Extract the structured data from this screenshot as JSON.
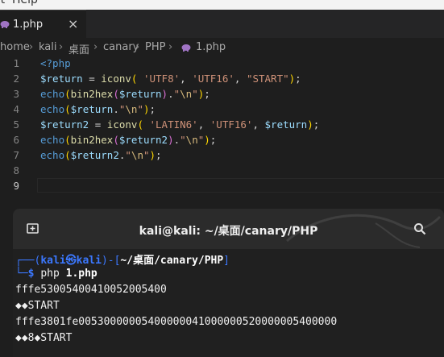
{
  "menubar": {
    "text": "at  Help"
  },
  "tab": {
    "label": "1.php",
    "close": "×"
  },
  "breadcrumb": [
    "home",
    "kali",
    "桌面",
    "canary",
    "PHP",
    "1.php"
  ],
  "breadcrumb_sep": "›",
  "editor": {
    "line_numbers": [
      "1",
      "2",
      "3",
      "4",
      "5",
      "6",
      "7",
      "8",
      "9"
    ],
    "active_line": "9"
  },
  "terminal": {
    "title": "kali@kali: ~/桌面/canary/PHP",
    "prompt_user": "kali㉿kali",
    "prompt_path": "~/桌面/canary/PHP",
    "command": "php",
    "command_arg": "1.php",
    "output": [
      "fffe53005400410052005400",
      "◆◆START",
      "fffe3801fe00530000005400000041000000520000005400000",
      "◆◆8◆START"
    ]
  },
  "colors": {
    "editor_bg": "#1e1e1e",
    "keyword": "#569cd6",
    "variable": "#9cdcfe",
    "string": "#ce9178",
    "function": "#dcdcaa",
    "prompt": "#3b78ff"
  },
  "icons": [
    "php-elephant-icon",
    "close-icon",
    "new-tab-icon",
    "search-icon"
  ]
}
